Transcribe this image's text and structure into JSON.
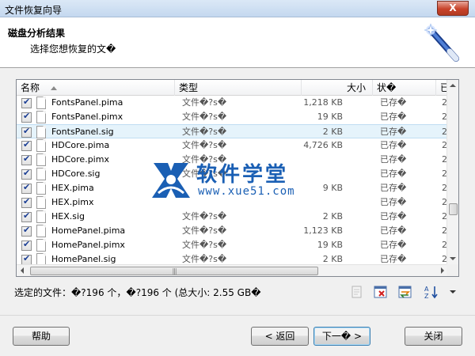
{
  "window": {
    "title": "文件恢复向导",
    "close_label": "X"
  },
  "header": {
    "title": "磁盘分析结果",
    "subtitle": "选择您想恢复的文�"
  },
  "table": {
    "columns": [
      "名称",
      "类型",
      "大小",
      "状�",
      "已修"
    ],
    "rows": [
      {
        "name": "FontsPanel.pima",
        "type": "文件�?s�",
        "size": "1,218 KB",
        "state": "已存�",
        "more": "2",
        "selected": false
      },
      {
        "name": "FontsPanel.pimx",
        "type": "文件�?s�",
        "size": "19 KB",
        "state": "已存�",
        "more": "2",
        "selected": false
      },
      {
        "name": "FontsPanel.sig",
        "type": "文件�?s�",
        "size": "2 KB",
        "state": "已存�",
        "more": "2",
        "selected": true
      },
      {
        "name": "HDCore.pima",
        "type": "文件�?s�",
        "size": "4,726 KB",
        "state": "已存�",
        "more": "2",
        "selected": false
      },
      {
        "name": "HDCore.pimx",
        "type": "文件�?s�",
        "size": "",
        "state": "已存�",
        "more": "2",
        "selected": false
      },
      {
        "name": "HDCore.sig",
        "type": "文件�?s�",
        "size": "",
        "state": "已存�",
        "more": "2",
        "selected": false
      },
      {
        "name": "HEX.pima",
        "type": "",
        "size": "9 KB",
        "state": "已存�",
        "more": "2",
        "selected": false
      },
      {
        "name": "HEX.pimx",
        "type": "",
        "size": "",
        "state": "已存�",
        "more": "2",
        "selected": false
      },
      {
        "name": "HEX.sig",
        "type": "文件�?s�",
        "size": "2 KB",
        "state": "已存�",
        "more": "2",
        "selected": false
      },
      {
        "name": "HomePanel.pima",
        "type": "文件�?s�",
        "size": "1,123 KB",
        "state": "已存�",
        "more": "2",
        "selected": false
      },
      {
        "name": "HomePanel.pimx",
        "type": "文件�?s�",
        "size": "19 KB",
        "state": "已存�",
        "more": "2",
        "selected": false
      },
      {
        "name": "HomePanel.sig",
        "type": "文件�?s�",
        "size": "2 KB",
        "state": "已存�",
        "more": "2",
        "selected": false
      }
    ]
  },
  "watermark": {
    "text": "软件学堂",
    "url": "www.xue51.com"
  },
  "status": {
    "text": "选定的文件：�?196 个，�?196 个 (总大小: 2.55 GB�"
  },
  "toolbar_icons": [
    "properties-icon",
    "clear-selection-icon",
    "filter-icon",
    "sort-icon",
    "dropdown-arrow-icon"
  ],
  "buttons": {
    "help": "帮助",
    "back": "< 返回",
    "next": "下一� >",
    "close": "关闭"
  },
  "colors": {
    "accent": "#1a5fb4",
    "selected_row": "#e5f3fb",
    "close_button": "#c8432a"
  }
}
